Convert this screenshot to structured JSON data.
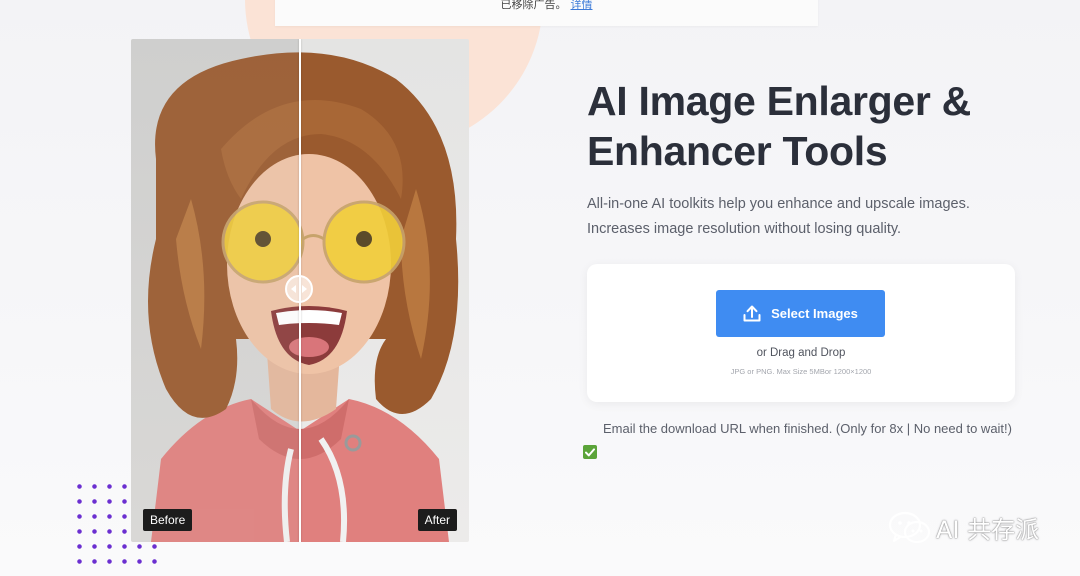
{
  "notice": {
    "text": "已移除广告。",
    "link": "详情"
  },
  "compare": {
    "before_label": "Before",
    "after_label": "After",
    "slider_position": 0.5
  },
  "hero": {
    "title": "AI Image Enlarger & Enhancer Tools",
    "subtitle": "All-in-one AI toolkits help you enhance and upscale images. Increases image resolution without losing quality."
  },
  "upload": {
    "button_label": "Select Images",
    "drag_text": "or Drag and Drop",
    "hint": "JPG or PNG. Max Size 5MBor 1200×1200"
  },
  "email_option": {
    "checked": true,
    "label": "Email the download URL when finished. (Only for 8x | No need to wait!)"
  },
  "watermark": {
    "text": "AI 共存派"
  },
  "colors": {
    "accent": "#3f8cf2",
    "checkbox": "#5ba439",
    "deco": "#fbe3d6",
    "dots": "#6b2fd0"
  }
}
